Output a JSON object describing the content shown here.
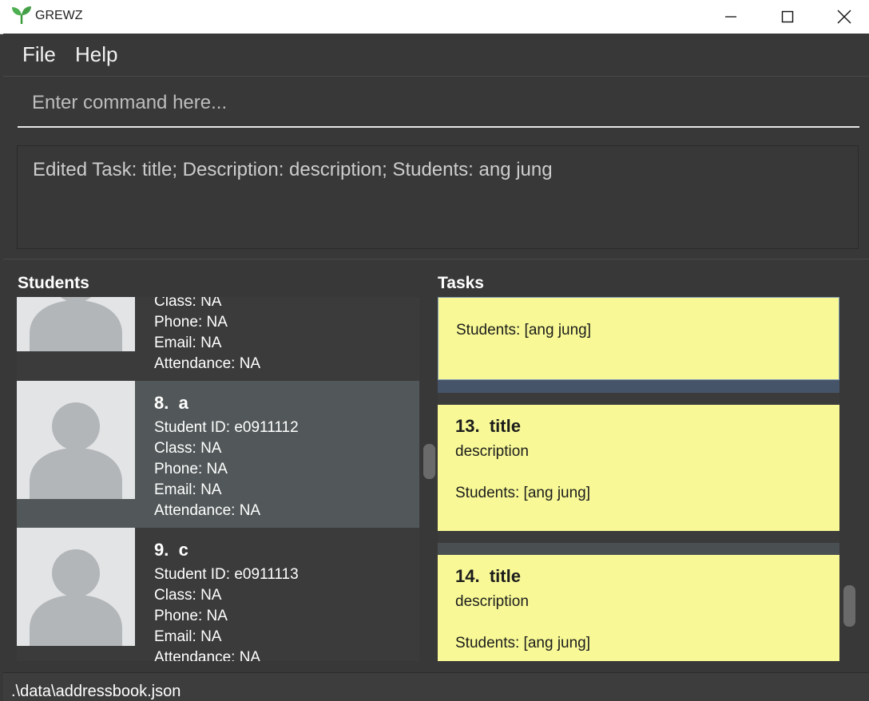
{
  "window": {
    "title": "GREWZ",
    "controls": [
      "minimize-icon",
      "maximize-icon",
      "close-icon"
    ]
  },
  "menu": {
    "file_label": "File",
    "help_label": "Help"
  },
  "command": {
    "placeholder": "Enter command here...",
    "value": ""
  },
  "result": {
    "text": "Edited Task: title; Description: description; Students: ang jung"
  },
  "students": {
    "title": "Students",
    "partial_top": {
      "class": "Class: NA",
      "phone": "Phone: NA",
      "email": "Email: NA",
      "attendance": "Attendance: NA"
    },
    "items": [
      {
        "index": "8.",
        "name": "a",
        "student_id": "Student ID: e0911112",
        "class": "Class: NA",
        "phone": "Phone: NA",
        "email": "Email: NA",
        "attendance": "Attendance: NA",
        "selected": true
      },
      {
        "index": "9.",
        "name": "c",
        "student_id": "Student ID: e0911113",
        "class": "Class: NA",
        "phone": "Phone: NA",
        "email": "Email: NA",
        "attendance": "Attendance: NA",
        "selected": false
      }
    ]
  },
  "tasks": {
    "title": "Tasks",
    "partial_top": {
      "students": "Students: [ang jung]"
    },
    "items": [
      {
        "index": "13.",
        "title": "title",
        "description": "description",
        "students": "Students: [ang jung]"
      },
      {
        "index": "14.",
        "title": "title",
        "description": "description",
        "students": "Students: [ang jung]"
      }
    ]
  },
  "status": {
    "path": ".\\data\\addressbook.json"
  },
  "colors": {
    "background": "#383838",
    "task_card": "#f8f996",
    "selected_student": "#525859",
    "avatar_bg": "#e3e4e6",
    "avatar_figure": "#b3b6b9"
  }
}
